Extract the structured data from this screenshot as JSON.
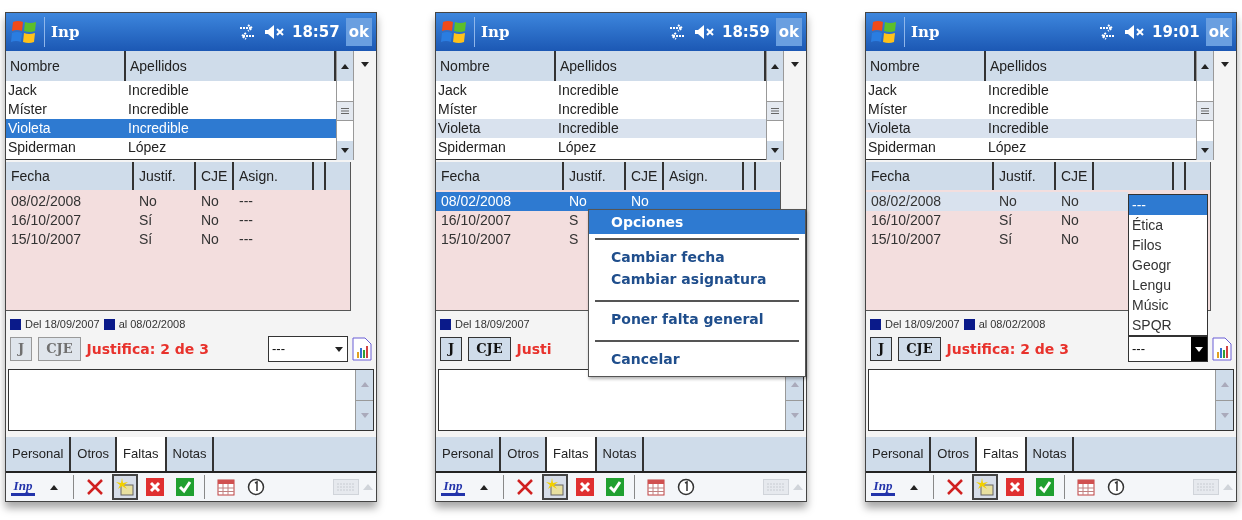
{
  "screens": [
    {
      "title": "Inp",
      "clock": "18:57",
      "ok": "ok",
      "student_list": {
        "columns": [
          "Nombre",
          "Apellidos"
        ],
        "focused": true,
        "rows": [
          {
            "cells": [
              "Jack",
              "Incredible"
            ],
            "selected": false
          },
          {
            "cells": [
              "Míster",
              "Incredible"
            ],
            "selected": false
          },
          {
            "cells": [
              "Violeta",
              "Incredible"
            ],
            "selected": true
          },
          {
            "cells": [
              "Spiderman",
              "López"
            ],
            "selected": false
          }
        ]
      },
      "absence_list": {
        "columns": [
          "Fecha",
          "Justif.",
          "CJE",
          "Asign."
        ],
        "rows": [
          {
            "cells": [
              "08/02/2008",
              "No",
              "No",
              "---"
            ],
            "selected": false
          },
          {
            "cells": [
              "16/10/2007",
              "Sí",
              "No",
              "---"
            ],
            "selected": false
          },
          {
            "cells": [
              "15/10/2007",
              "Sí",
              "No",
              "---"
            ],
            "selected": false
          }
        ]
      },
      "legend": [
        "Del 18/09/2007",
        "al 08/02/2008"
      ],
      "buttons": [
        {
          "label": "J",
          "disabled": true
        },
        {
          "label": "CJE",
          "disabled": true
        }
      ],
      "summary": "Justifica: 2 de 3",
      "subject_select": {
        "value": "---",
        "open": false
      },
      "tabs": [
        {
          "label": "Personal",
          "selected": false
        },
        {
          "label": "Otros",
          "selected": false
        },
        {
          "label": "Faltas",
          "selected": true
        },
        {
          "label": "Notas",
          "selected": false
        }
      ],
      "toolbar": [
        {
          "kind": "logo",
          "label": "Inp",
          "pressed": false
        },
        {
          "kind": "caret",
          "pressed": false
        },
        {
          "kind": "sep",
          "pressed": false
        },
        {
          "kind": "delete",
          "pressed": false
        },
        {
          "kind": "new",
          "pressed": true
        },
        {
          "kind": "cancel",
          "pressed": false
        },
        {
          "kind": "accept",
          "pressed": false
        },
        {
          "kind": "sep",
          "pressed": false
        },
        {
          "kind": "calendar",
          "pressed": false
        },
        {
          "kind": "clock",
          "pressed": false
        }
      ]
    },
    {
      "title": "Inp",
      "clock": "18:59",
      "ok": "ok",
      "student_list": {
        "columns": [
          "Nombre",
          "Apellidos"
        ],
        "focused": false,
        "rows": [
          {
            "cells": [
              "Jack",
              "Incredible"
            ],
            "selected": false
          },
          {
            "cells": [
              "Míster",
              "Incredible"
            ],
            "selected": false
          },
          {
            "cells": [
              "Violeta",
              "Incredible"
            ],
            "selected": true
          },
          {
            "cells": [
              "Spiderman",
              "López"
            ],
            "selected": false
          }
        ]
      },
      "absence_list": {
        "columns": [
          "Fecha",
          "Justif.",
          "CJE",
          "Asign."
        ],
        "focused": true,
        "rows": [
          {
            "cells": [
              "08/02/2008",
              "No",
              "No"
            ],
            "selected": true
          },
          {
            "cells": [
              "16/10/2007",
              "S"
            ],
            "selected": false
          },
          {
            "cells": [
              "15/10/2007",
              "S"
            ],
            "selected": false
          }
        ]
      },
      "legend": [
        "Del 18/09/2007"
      ],
      "buttons": [
        {
          "label": "J",
          "disabled": false
        },
        {
          "label": "CJE",
          "disabled": false
        }
      ],
      "summary": "Justi",
      "tabs": [
        {
          "label": "Personal",
          "selected": false
        },
        {
          "label": "Otros",
          "selected": false
        },
        {
          "label": "Faltas",
          "selected": true
        },
        {
          "label": "Notas",
          "selected": false
        }
      ],
      "toolbar": [
        {
          "kind": "logo",
          "label": "Inp",
          "pressed": false
        },
        {
          "kind": "caret",
          "pressed": false
        },
        {
          "kind": "sep",
          "pressed": false
        },
        {
          "kind": "delete",
          "pressed": false
        },
        {
          "kind": "new",
          "pressed": true
        },
        {
          "kind": "cancel",
          "pressed": false
        },
        {
          "kind": "accept",
          "pressed": false
        },
        {
          "kind": "sep",
          "pressed": false
        },
        {
          "kind": "calendar",
          "pressed": false
        },
        {
          "kind": "clock",
          "pressed": false
        }
      ],
      "menu": {
        "title": "Opciones",
        "groups": [
          [
            "Cambiar fecha",
            "Cambiar asignatura"
          ],
          [
            "Poner falta general"
          ],
          [
            "Cancelar"
          ]
        ]
      }
    },
    {
      "title": "Inp",
      "clock": "19:01",
      "ok": "ok",
      "student_list": {
        "columns": [
          "Nombre",
          "Apellidos"
        ],
        "focused": false,
        "rows": [
          {
            "cells": [
              "Jack",
              "Incredible"
            ],
            "selected": false
          },
          {
            "cells": [
              "Míster",
              "Incredible"
            ],
            "selected": false
          },
          {
            "cells": [
              "Violeta",
              "Incredible"
            ],
            "selected": true
          },
          {
            "cells": [
              "Spiderman",
              "López"
            ],
            "selected": false
          }
        ]
      },
      "absence_list": {
        "columns": [
          "Fecha",
          "Justif.",
          "CJE"
        ],
        "focused": false,
        "rows": [
          {
            "cells": [
              "08/02/2008",
              "No",
              "No"
            ],
            "selected": true
          },
          {
            "cells": [
              "16/10/2007",
              "Sí",
              "No"
            ],
            "selected": false
          },
          {
            "cells": [
              "15/10/2007",
              "Sí",
              "No"
            ],
            "selected": false
          }
        ]
      },
      "legend": [
        "Del 18/09/2007",
        "al 08/02/2008"
      ],
      "buttons": [
        {
          "label": "J",
          "disabled": false
        },
        {
          "label": "CJE",
          "disabled": false
        }
      ],
      "summary": "Justifica: 2 de 3",
      "subject_select": {
        "value": "---",
        "open": true,
        "options": [
          {
            "label": "---",
            "selected": true
          },
          {
            "label": "Ética",
            "selected": false
          },
          {
            "label": "Filos",
            "selected": false
          },
          {
            "label": "Geogr",
            "selected": false
          },
          {
            "label": "Lengu",
            "selected": false
          },
          {
            "label": "Músic",
            "selected": false
          },
          {
            "label": "SPQR",
            "selected": false
          }
        ]
      },
      "tabs": [
        {
          "label": "Personal",
          "selected": false
        },
        {
          "label": "Otros",
          "selected": false
        },
        {
          "label": "Faltas",
          "selected": true
        },
        {
          "label": "Notas",
          "selected": false
        }
      ],
      "toolbar": [
        {
          "kind": "logo",
          "label": "Inp",
          "pressed": false
        },
        {
          "kind": "caret",
          "pressed": false
        },
        {
          "kind": "sep",
          "pressed": false
        },
        {
          "kind": "delete",
          "pressed": false
        },
        {
          "kind": "new",
          "pressed": true
        },
        {
          "kind": "cancel",
          "pressed": false
        },
        {
          "kind": "accept",
          "pressed": false
        },
        {
          "kind": "sep",
          "pressed": false
        },
        {
          "kind": "calendar",
          "pressed": false
        },
        {
          "kind": "clock",
          "pressed": false
        }
      ]
    }
  ]
}
